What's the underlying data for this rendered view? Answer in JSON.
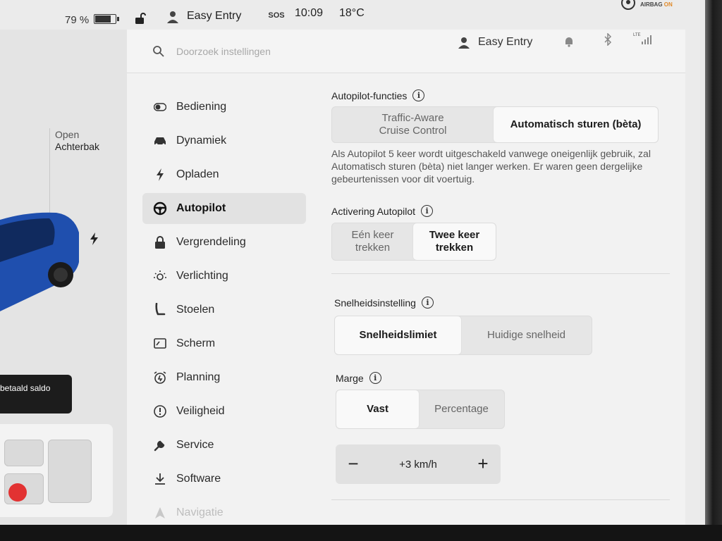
{
  "status": {
    "battery_pct": "79 %",
    "profile_name": "Easy Entry",
    "sos": "SOS",
    "time": "10:09",
    "temperature": "18°C",
    "airbag_label": "AIRBAG",
    "airbag_state": "ON"
  },
  "car_panel": {
    "trunk_open": "Open",
    "trunk_name": "Achterbak",
    "balance_tip": "betaald saldo"
  },
  "header": {
    "search_placeholder": "Doorzoek instellingen",
    "profile_name": "Easy Entry"
  },
  "nav": {
    "items": [
      {
        "label": "Bediening",
        "icon": "toggle-icon"
      },
      {
        "label": "Dynamiek",
        "icon": "car-icon"
      },
      {
        "label": "Opladen",
        "icon": "bolt-icon"
      },
      {
        "label": "Autopilot",
        "icon": "steering-wheel-icon",
        "active": true
      },
      {
        "label": "Vergrendeling",
        "icon": "lock-icon"
      },
      {
        "label": "Verlichting",
        "icon": "sun-icon"
      },
      {
        "label": "Stoelen",
        "icon": "seat-icon"
      },
      {
        "label": "Scherm",
        "icon": "screen-icon"
      },
      {
        "label": "Planning",
        "icon": "alarm-clock-icon"
      },
      {
        "label": "Veiligheid",
        "icon": "exclamation-icon"
      },
      {
        "label": "Service",
        "icon": "wrench-icon"
      },
      {
        "label": "Software",
        "icon": "download-icon"
      },
      {
        "label": "Navigatie",
        "icon": "navigation-arrow-icon"
      }
    ]
  },
  "autopilot": {
    "functions": {
      "title": "Autopilot-functies",
      "options": [
        "Traffic-Aware\nCruise Control",
        "Automatisch sturen (bèta)"
      ],
      "selected": "Automatisch sturen (bèta)",
      "description": "Als Autopilot 5 keer wordt uitgeschakeld vanwege oneigenlijk gebruik, zal Automatisch sturen (bèta) niet langer werken. Er waren geen dergelijke gebeurtenissen voor dit voertuig."
    },
    "activation": {
      "title": "Activering Autopilot",
      "options": [
        "Eén keer\ntrekken",
        "Twee keer\ntrekken"
      ],
      "selected": "Twee keer\ntrekken"
    },
    "speed_setting": {
      "title": "Snelheidsinstelling",
      "options": [
        "Snelheidslimiet",
        "Huidige snelheid"
      ],
      "selected": "Snelheidslimiet"
    },
    "margin": {
      "title": "Marge",
      "options": [
        "Vast",
        "Percentage"
      ],
      "selected": "Vast",
      "value": "+3 km/h",
      "minus": "−",
      "plus": "+"
    }
  },
  "colors": {
    "active_bg": "#e2e2e2",
    "seat_heat": "#e23232",
    "car_blue": "#1f4fae"
  }
}
